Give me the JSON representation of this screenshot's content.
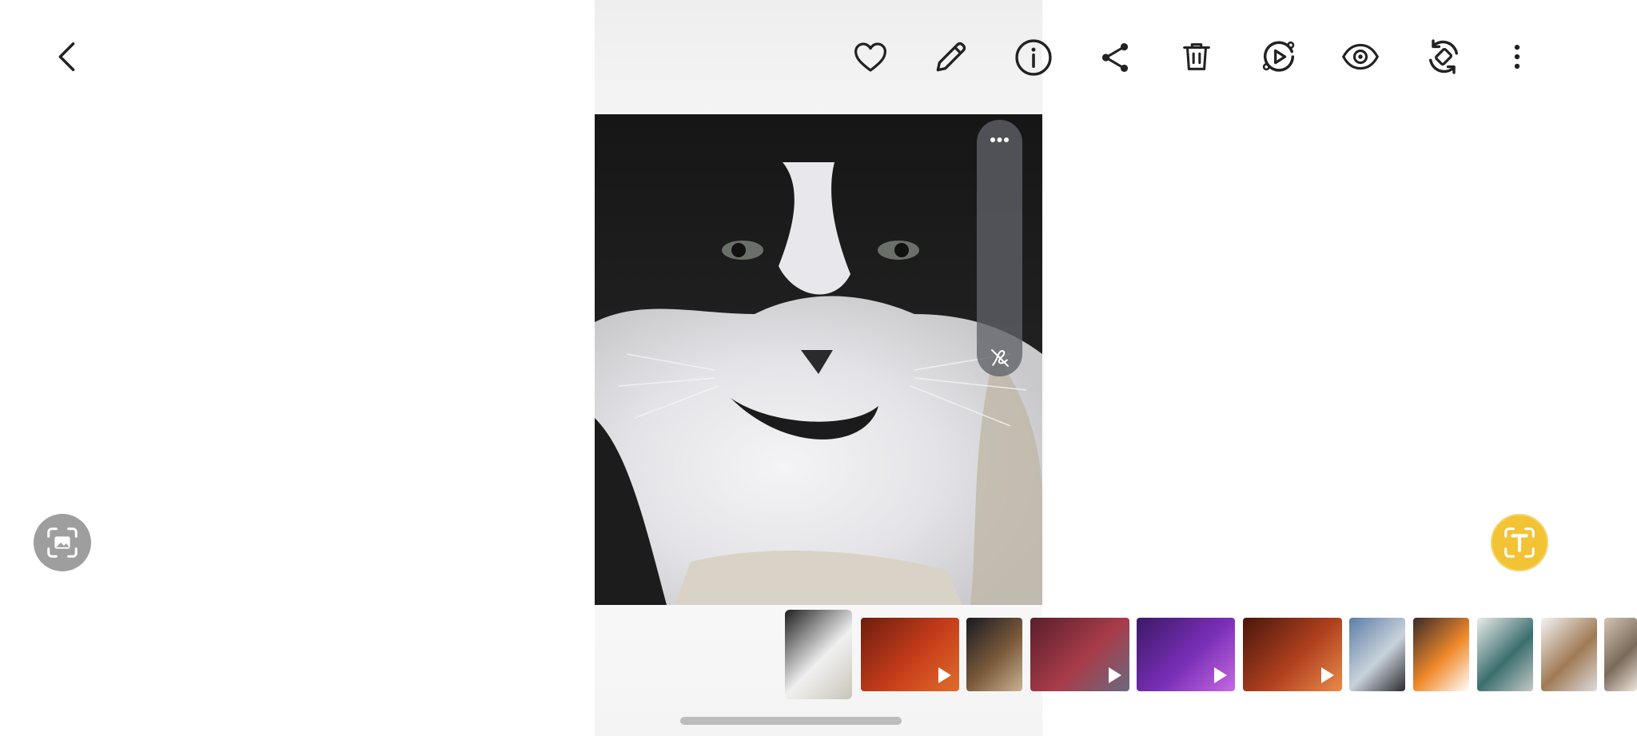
{
  "toolbar": {
    "back": "back-icon",
    "actions": [
      "heart-icon",
      "edit-pencil-icon",
      "info-icon",
      "share-icon",
      "delete-icon",
      "remaster-video-icon",
      "view-eye-icon",
      "rotate-icon",
      "more-options-icon"
    ]
  },
  "photo": {
    "subject": "cat",
    "side_panel": {
      "top": "more-dots-icon",
      "bottom": "draw-off-icon"
    }
  },
  "buttons": {
    "left": "scan-image-icon",
    "right": "extract-text-icon"
  },
  "filmstrip": {
    "selected_index": 0,
    "items": [
      {
        "type": "photo",
        "palette": [
          "#1f1f1f",
          "#f0f0f0",
          "#c8c4b8"
        ]
      },
      {
        "type": "video",
        "palette": [
          "#6e1d10",
          "#c73d1a",
          "#e06c2c"
        ]
      },
      {
        "type": "photo",
        "palette": [
          "#1a1a22",
          "#7b5a3a",
          "#c8b291"
        ]
      },
      {
        "type": "video",
        "palette": [
          "#5a1f2a",
          "#a83b4a",
          "#6a6a80"
        ]
      },
      {
        "type": "video",
        "palette": [
          "#3b1966",
          "#7a2fb8",
          "#c56ae0"
        ]
      },
      {
        "type": "video",
        "palette": [
          "#4a160d",
          "#b0401e",
          "#e98b4a"
        ]
      },
      {
        "type": "photo",
        "palette": [
          "#5b7fa6",
          "#c9d2db",
          "#2b2b30"
        ]
      },
      {
        "type": "photo",
        "palette": [
          "#3a2b2b",
          "#f08a2a",
          "#ffffff"
        ]
      },
      {
        "type": "photo",
        "palette": [
          "#e9ece9",
          "#3b6e6e",
          "#c5c9c7"
        ]
      },
      {
        "type": "photo",
        "palette": [
          "#f3f3f3",
          "#a07a55",
          "#dcdcdc"
        ]
      },
      {
        "type": "photo",
        "palette": [
          "#d2c3b2",
          "#7a6a5a",
          "#efe6dc"
        ]
      }
    ]
  },
  "colors": {
    "accent": "#f2c335",
    "icon": "#222222",
    "panel": "#606268"
  }
}
